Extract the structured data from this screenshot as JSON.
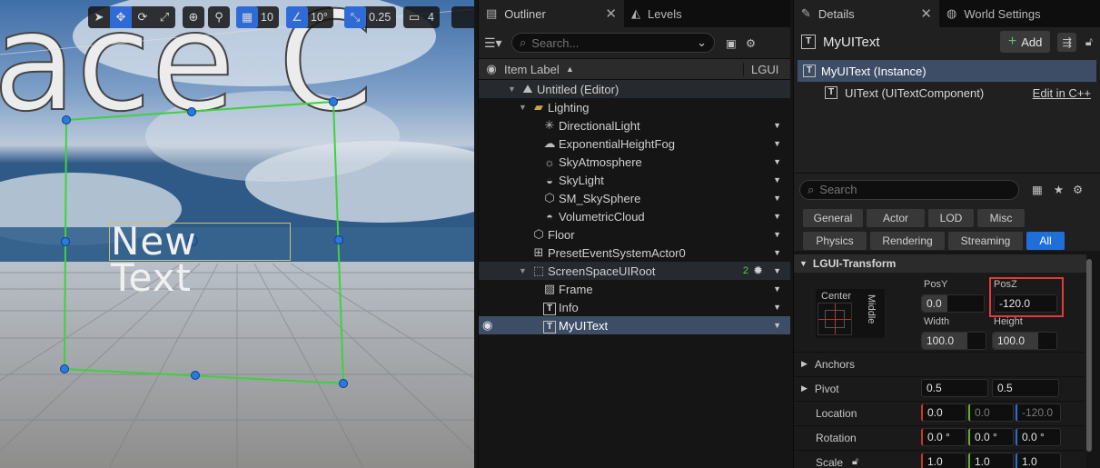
{
  "viewport": {
    "toolbar": {
      "grid_snap": "10",
      "rotation_snap": "10°",
      "scale_snap": "0.25",
      "camera_speed": "4"
    },
    "scene_text_watermark": "ace C",
    "widget_text": "New Text"
  },
  "outliner": {
    "tab_label": "Outliner",
    "levels_tab_label": "Levels",
    "search_placeholder": "Search...",
    "col_item_label": "Item Label",
    "col_type": "LGUI",
    "items": [
      {
        "label": "Untitled (Editor)",
        "icon": "level-icon"
      },
      {
        "label": "Lighting",
        "icon": "folder-icon"
      },
      {
        "label": "DirectionalLight",
        "icon": "directional-light-icon"
      },
      {
        "label": "ExponentialHeightFog",
        "icon": "fog-icon"
      },
      {
        "label": "SkyAtmosphere",
        "icon": "sky-atmosphere-icon"
      },
      {
        "label": "SkyLight",
        "icon": "skylight-icon"
      },
      {
        "label": "SM_SkySphere",
        "icon": "mesh-icon"
      },
      {
        "label": "VolumetricCloud",
        "icon": "cloud-icon"
      },
      {
        "label": "Floor",
        "icon": "mesh-icon"
      },
      {
        "label": "PresetEventSystemActor0",
        "icon": "actor-icon"
      },
      {
        "label": "ScreenSpaceUIRoot",
        "icon": "ui-root-icon",
        "badge": "2"
      },
      {
        "label": "Frame",
        "icon": "image-icon"
      },
      {
        "label": "Info",
        "icon": "text-icon"
      },
      {
        "label": "MyUIText",
        "icon": "text-icon"
      }
    ]
  },
  "details": {
    "tab_label": "Details",
    "world_settings_tab_label": "World Settings",
    "actor_name": "MyUIText",
    "add_label": "Add",
    "components": [
      {
        "label": "MyUIText (Instance)"
      },
      {
        "label": "UIText (UITextComponent)",
        "link": "Edit in C++"
      }
    ],
    "search_placeholder": "Search",
    "filters_row1": [
      "General",
      "Actor",
      "LOD",
      "Misc"
    ],
    "filters_row2": [
      "Physics",
      "Rendering",
      "Streaming",
      "All"
    ],
    "category": "LGUI-Transform",
    "anchor_h": "Center",
    "anchor_v": "Middle",
    "posy_label": "PosY",
    "posy_value": "0.0",
    "posz_label": "PosZ",
    "posz_value": "-120.0",
    "width_label": "Width",
    "width_value": "100.0",
    "height_label": "Height",
    "height_value": "100.0",
    "anchors_label": "Anchors",
    "pivot_label": "Pivot",
    "pivot": [
      "0.5",
      "0.5"
    ],
    "location_label": "Location",
    "location": [
      "0.0",
      "0.0",
      "-120.0"
    ],
    "rotation_label": "Rotation",
    "rotation": [
      "0.0 °",
      "0.0 °",
      "0.0 °"
    ],
    "scale_label": "Scale",
    "scale": [
      "1.0",
      "1.0",
      "1.0"
    ],
    "highlight_color": "#e03a3a"
  }
}
